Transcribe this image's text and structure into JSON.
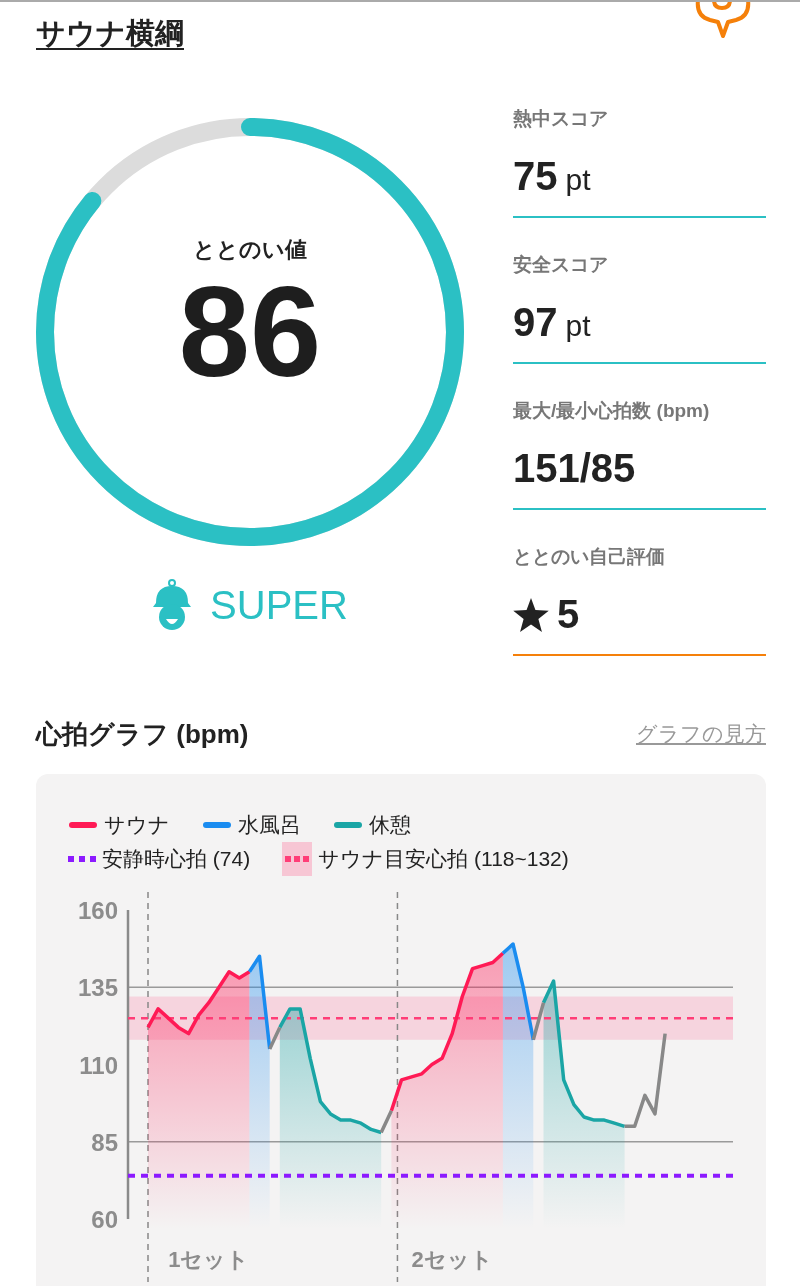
{
  "header": {
    "title": "サウナ横綱"
  },
  "score": {
    "label": "ととのい値",
    "value": "86",
    "level": 0.86
  },
  "rank": {
    "label": "SUPER"
  },
  "stats": [
    {
      "kind": "score",
      "label": "熱中スコア",
      "value": "75",
      "unit": "pt"
    },
    {
      "kind": "score",
      "label": "安全スコア",
      "value": "97",
      "unit": "pt"
    },
    {
      "kind": "score",
      "label": "最大/最小心拍数 (bpm)",
      "value": "151/85"
    },
    {
      "kind": "rating",
      "label": "ととのい自己評価",
      "value": "5"
    }
  ],
  "graph": {
    "title": "心拍グラフ (bpm)",
    "help_link": "グラフの見方",
    "legend": [
      {
        "kind": "dotted",
        "label": "安静時心拍 (74)",
        "color": "#8c1aff"
      },
      {
        "kind": "band",
        "label": "サウナ目安心拍 (118~132)",
        "color": "#ff3d77"
      }
    ],
    "chart_data": {
      "type": "line",
      "categories": [
        null,
        null,
        null,
        null,
        null,
        null,
        "1セット",
        null,
        null,
        null,
        null,
        null,
        null,
        null,
        null,
        null,
        null,
        null,
        null,
        null,
        null,
        null,
        null,
        null,
        null,
        null,
        null,
        null,
        null,
        null,
        "2セット",
        null,
        null,
        null,
        null,
        null,
        null,
        null,
        null,
        null,
        null,
        null,
        null,
        null,
        null,
        null,
        null,
        null,
        null,
        null,
        null,
        null
      ],
      "series": [
        {
          "name": "サウナ",
          "color": "#ff1a55",
          "values": [
            122,
            128,
            125,
            122,
            120,
            126,
            130,
            135,
            140,
            138,
            140,
            null,
            null,
            null,
            null,
            null,
            null,
            null,
            null,
            null,
            null,
            null,
            null,
            null,
            95,
            105,
            106,
            107,
            110,
            112,
            120,
            132,
            141,
            142,
            143,
            146,
            null,
            null,
            null,
            null,
            null,
            null,
            null,
            null,
            null,
            null,
            null,
            null,
            null,
            null,
            null,
            null
          ]
        },
        {
          "name": "水風呂",
          "color": "#1a8cf0",
          "values": [
            null,
            null,
            null,
            null,
            null,
            null,
            null,
            null,
            null,
            null,
            140,
            145,
            115,
            null,
            null,
            null,
            null,
            null,
            null,
            null,
            null,
            null,
            null,
            null,
            null,
            null,
            null,
            null,
            null,
            null,
            null,
            null,
            null,
            null,
            null,
            146,
            149,
            135,
            118,
            null,
            null,
            null,
            null,
            null,
            null,
            null,
            null,
            null,
            null,
            null,
            null,
            null
          ]
        },
        {
          "name": "休憩",
          "color": "#1aa5a5",
          "values": [
            null,
            null,
            null,
            null,
            null,
            null,
            null,
            null,
            null,
            null,
            null,
            null,
            null,
            122,
            128,
            128,
            112,
            98,
            94,
            92,
            92,
            91,
            89,
            88,
            null,
            null,
            null,
            null,
            null,
            null,
            null,
            null,
            null,
            null,
            null,
            null,
            null,
            null,
            null,
            130,
            137,
            105,
            97,
            93,
            92,
            92,
            91,
            90,
            null,
            null,
            null,
            null
          ]
        },
        {
          "color": "#888888",
          "values": [
            null,
            null,
            null,
            null,
            null,
            null,
            null,
            null,
            null,
            null,
            null,
            null,
            115,
            122,
            null,
            null,
            null,
            null,
            null,
            null,
            null,
            null,
            null,
            88,
            95,
            null,
            null,
            null,
            null,
            null,
            null,
            null,
            null,
            null,
            null,
            null,
            null,
            null,
            118,
            130,
            null,
            null,
            null,
            null,
            null,
            null,
            null,
            90,
            90,
            100,
            94,
            120
          ]
        }
      ],
      "ylim": [
        60,
        160
      ],
      "yticks": [
        60,
        85,
        110,
        135,
        160
      ],
      "bands": [
        {
          "axis": "y",
          "from": 118,
          "to": 132
        }
      ],
      "ref_lines": [
        {
          "axis": "y",
          "value": 125
        },
        {
          "axis": "y",
          "value": 74
        }
      ]
    }
  }
}
